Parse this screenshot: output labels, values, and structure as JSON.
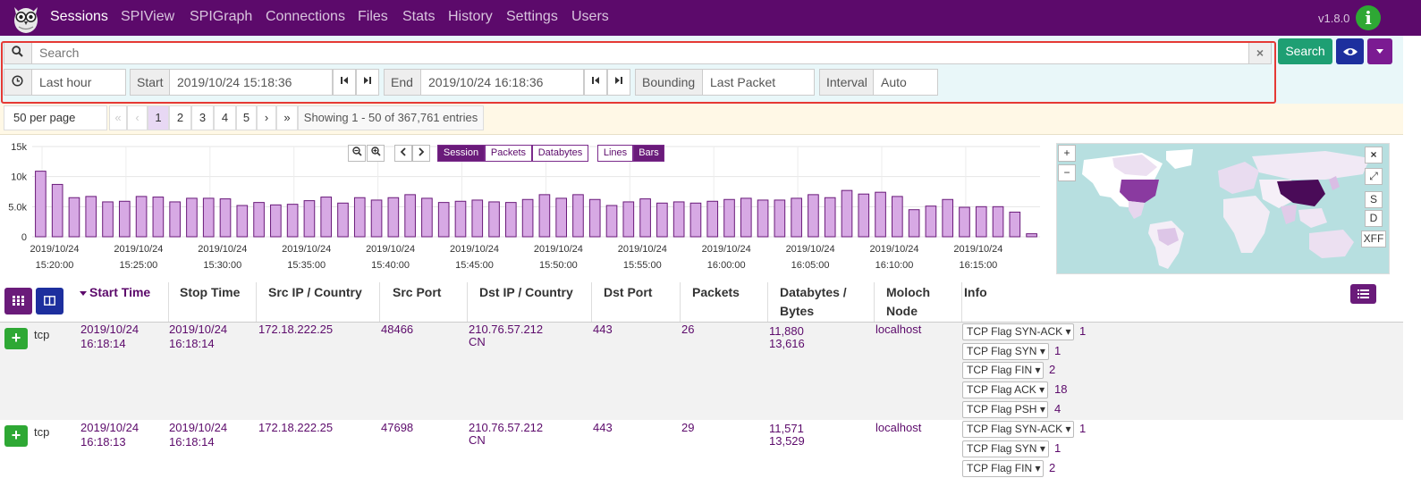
{
  "nav": {
    "items": [
      "Sessions",
      "SPIView",
      "SPIGraph",
      "Connections",
      "Files",
      "Stats",
      "History",
      "Settings",
      "Users"
    ],
    "version": "v1.8.0",
    "info_icon": "i"
  },
  "search": {
    "placeholder": "Search",
    "clear_icon": "×",
    "button_label": "Search",
    "time_range": "Last hour",
    "start_label": "Start",
    "start_value": "2019/10/24 15:18:36",
    "end_label": "End",
    "end_value": "2019/10/24 16:18:36",
    "bounding_label": "Bounding",
    "bounding_value": "Last Packet",
    "interval_label": "Interval",
    "interval_value": "Auto"
  },
  "pagination": {
    "per_page": "50 per page",
    "pages": [
      "1",
      "2",
      "3",
      "4",
      "5",
      "›",
      "»"
    ],
    "prev": [
      "«",
      "‹"
    ],
    "showing": "Showing 1 - 50 of 367,761 entries"
  },
  "chart_controls": {
    "type_tabs": [
      "Session",
      "Packets",
      "Databytes"
    ],
    "style_tabs": [
      "Lines",
      "Bars"
    ]
  },
  "chart_data": {
    "type": "bar",
    "y_ticks": [
      "15k",
      "10k",
      "5.0k",
      "0"
    ],
    "ylim": [
      0,
      15000
    ],
    "x_tick_labels": [
      [
        "2019/10/24",
        "15:20:00"
      ],
      [
        "2019/10/24",
        "15:25:00"
      ],
      [
        "2019/10/24",
        "15:30:00"
      ],
      [
        "2019/10/24",
        "15:35:00"
      ],
      [
        "2019/10/24",
        "15:40:00"
      ],
      [
        "2019/10/24",
        "15:45:00"
      ],
      [
        "2019/10/24",
        "15:50:00"
      ],
      [
        "2019/10/24",
        "15:55:00"
      ],
      [
        "2019/10/24",
        "16:00:00"
      ],
      [
        "2019/10/24",
        "16:05:00"
      ],
      [
        "2019/10/24",
        "16:10:00"
      ],
      [
        "2019/10/24",
        "16:15:00"
      ]
    ],
    "values": [
      10900,
      8700,
      6500,
      6700,
      5800,
      5900,
      6700,
      6600,
      5800,
      6400,
      6400,
      6300,
      5200,
      5700,
      5300,
      5400,
      6000,
      6600,
      5600,
      6500,
      6100,
      6500,
      7000,
      6400,
      5700,
      5900,
      6100,
      5800,
      5700,
      6200,
      7000,
      6400,
      7000,
      6200,
      5200,
      5800,
      6300,
      5600,
      5800,
      5600,
      5900,
      6200,
      6400,
      6100,
      6100,
      6400,
      7000,
      6500,
      7700,
      7100,
      7400,
      6700,
      4500,
      5100,
      6200,
      4900,
      5000,
      5000,
      4100,
      500
    ],
    "grid": true
  },
  "map_controls": {
    "zoom_in": "+",
    "zoom_out": "−",
    "close": "×",
    "expand": "⤢",
    "src": "S",
    "dst": "D",
    "xff": "XFF"
  },
  "table": {
    "headers": [
      "Start Time",
      "Stop Time",
      "Src IP / Country",
      "Src Port",
      "Dst IP / Country",
      "Dst Port",
      "Packets",
      "Databytes /",
      "Bytes",
      "Moloch",
      "Node",
      "Info"
    ],
    "rows": [
      {
        "protocol": "tcp",
        "start_date": "2019/10/24",
        "start_time": "16:18:14",
        "stop_date": "2019/10/24",
        "stop_time": "16:18:14",
        "src_ip": "172.18.222.25",
        "src_port": "48466",
        "dst_ip": "210.76.57.212",
        "dst_country": "CN",
        "dst_port": "443",
        "packets": "26",
        "databytes": "11,880",
        "bytes": "13,616",
        "node": "localhost",
        "flags": [
          {
            "label": "TCP Flag SYN-ACK",
            "count": "1"
          },
          {
            "label": "TCP Flag SYN",
            "count": "1"
          },
          {
            "label": "TCP Flag FIN",
            "count": "2"
          },
          {
            "label": "TCP Flag ACK",
            "count": "18"
          },
          {
            "label": "TCP Flag PSH",
            "count": "4"
          }
        ]
      },
      {
        "protocol": "tcp",
        "start_date": "2019/10/24",
        "start_time": "16:18:13",
        "stop_date": "2019/10/24",
        "stop_time": "16:18:14",
        "src_ip": "172.18.222.25",
        "src_port": "47698",
        "dst_ip": "210.76.57.212",
        "dst_country": "CN",
        "dst_port": "443",
        "packets": "29",
        "databytes": "11,571",
        "bytes": "13,529",
        "node": "localhost",
        "flags": [
          {
            "label": "TCP Flag SYN-ACK",
            "count": "1"
          },
          {
            "label": "TCP Flag SYN",
            "count": "1"
          },
          {
            "label": "TCP Flag FIN",
            "count": "2"
          }
        ]
      }
    ]
  },
  "colors": {
    "brand": "#5c0a6b",
    "bar_fill": "#d7a9e4",
    "bar_stroke": "#6a1b7a",
    "search_button": "#1e9f73",
    "view_button": "#1d2f9e",
    "highlight": "#e53935"
  }
}
